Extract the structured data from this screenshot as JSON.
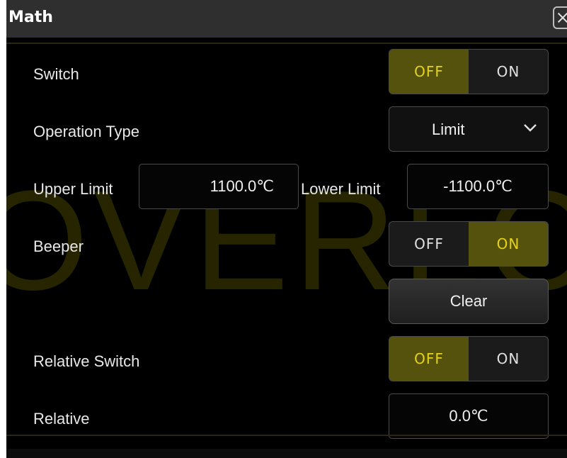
{
  "dialog": {
    "title": "Math",
    "watermark": "OVERLO"
  },
  "switch": {
    "label": "Switch",
    "off": "OFF",
    "on": "ON",
    "state": "OFF"
  },
  "operation_type": {
    "label": "Operation Type",
    "value": "Limit"
  },
  "upper_limit": {
    "label": "Upper Limit",
    "value": "1100.0℃"
  },
  "lower_limit": {
    "label": "Lower Limit",
    "value": "-1100.0℃"
  },
  "beeper": {
    "label": "Beeper",
    "off": "OFF",
    "on": "ON",
    "state": "ON"
  },
  "clear": {
    "label": "Clear"
  },
  "relative_switch": {
    "label": "Relative Switch",
    "off": "OFF",
    "on": "ON",
    "state": "OFF"
  },
  "relative": {
    "label": "Relative",
    "value": "0.0℃"
  },
  "colors": {
    "active_bg": "#55520e",
    "active_text": "#e6d21a",
    "background": "#000000",
    "titlebar": "#2f2f2f"
  },
  "icons": {
    "close": "close-icon",
    "dropdown": "chevron-down-icon"
  }
}
